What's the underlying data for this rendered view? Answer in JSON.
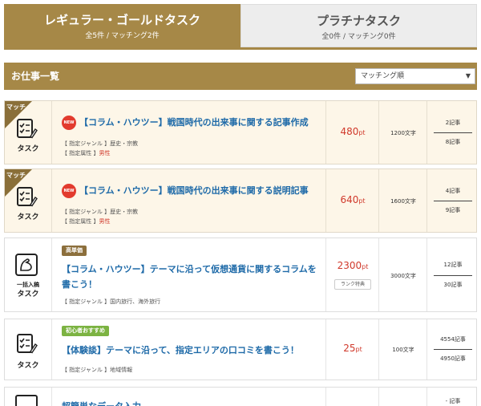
{
  "tabs": [
    {
      "title": "レギュラー・ゴールドタスク",
      "sub": "全5件 / マッチング2件"
    },
    {
      "title": "プラチナタスク",
      "sub": "全0件 / マッチング0件"
    }
  ],
  "list": {
    "title": "お仕事一覧",
    "sort": {
      "selected": "マッチング順",
      "arrow": "▼"
    }
  },
  "labels": {
    "match": "マッチ",
    "new": "NEW",
    "task": "タスク",
    "bulk": "一括入稿",
    "task2": "タスク"
  },
  "tasks": [
    {
      "title": "【コラム・ハウツー】戦国時代の出来事に関する記事作成",
      "genre": "【 指定ジャンル 】歴史・宗教",
      "attr_label": "【 指定属性 】",
      "attr_value": "男性",
      "price": "480",
      "unit": "pt",
      "chars": "1200文字",
      "count_top": "2記事",
      "count_bottom": "8記事"
    },
    {
      "title": "【コラム・ハウツー】戦国時代の出来事に関する説明記事",
      "genre": "【 指定ジャンル 】歴史・宗教",
      "attr_label": "【 指定属性 】",
      "attr_value": "男性",
      "price": "640",
      "unit": "pt",
      "chars": "1600文字",
      "count_top": "4記事",
      "count_bottom": "9記事"
    },
    {
      "tag": "高単価",
      "title": "【コラム・ハウツー】テーマに沿って仮想通貨に関するコラムを書こう！",
      "genre": "【 指定ジャンル 】国内旅行、海外旅行",
      "price": "2300",
      "unit": "pt",
      "rank": "ランク特典",
      "chars": "3000文字",
      "count_top": "12記事",
      "count_bottom": "30記事"
    },
    {
      "tag": "初心者おすすめ",
      "title": "【体験談】テーマに沿って、指定エリアの口コミを書こう！",
      "genre": "【 指定ジャンル 】地域情報",
      "price": "25",
      "unit": "pt",
      "chars": "100文字",
      "count_top": "4554記事",
      "count_bottom": "4950記事"
    },
    {
      "title": "超簡単なデータ入力",
      "count_top": "- 記事"
    }
  ],
  "colors": {
    "accent": "#a68847",
    "title_blue": "#1e6aa8",
    "price_red": "#d0392b",
    "match_bg": "#fdf6e8"
  }
}
